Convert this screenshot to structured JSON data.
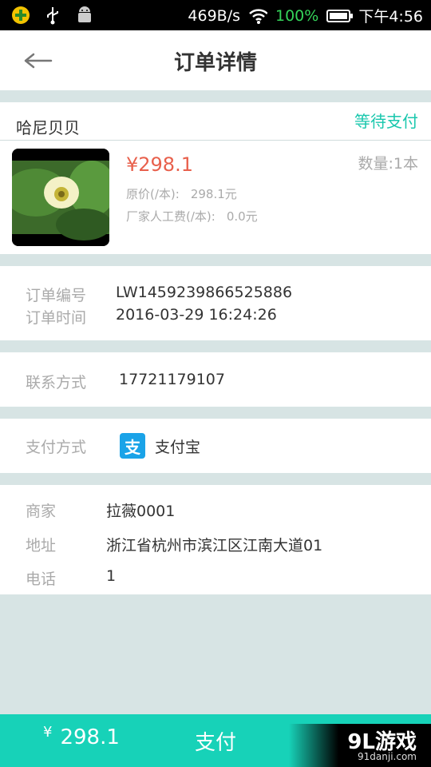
{
  "status_bar": {
    "network_speed": "469B/s",
    "battery_percent": "100%",
    "time": "下午4:56"
  },
  "header": {
    "title": "订单详情"
  },
  "shop": {
    "name": "哈尼贝贝",
    "order_status": "等待支付",
    "item": {
      "price": "¥298.1",
      "quantity": "数量:1本",
      "original_price_label": "原价(/本):",
      "original_price_value": "298.1元",
      "labor_fee_label": "厂家人工费(/本):",
      "labor_fee_value": "0.0元"
    }
  },
  "order_info": {
    "number_label": "订单编号",
    "number_value": "LW1459239866525886",
    "time_label": "订单时间",
    "time_value": "2016-03-29 16:24:26"
  },
  "contact": {
    "label": "联系方式",
    "value": "17721179107"
  },
  "payment": {
    "label": "支付方式",
    "method": "支付宝",
    "icon_glyph": "支"
  },
  "merchant": {
    "name_label": "商家",
    "name_value": "拉薇0001",
    "address_label": "地址",
    "address_value": "浙江省杭州市滨江区江南大道01",
    "phone_label": "电话",
    "phone_value": "1"
  },
  "footer": {
    "currency": "¥",
    "total": "298.1",
    "pay_label": "支付"
  },
  "watermark": {
    "logo": "9L游戏",
    "url": "91danji.com"
  },
  "colors": {
    "accent": "#17d2b8",
    "price_red": "#e8604c",
    "background": "#d7e4e4"
  }
}
